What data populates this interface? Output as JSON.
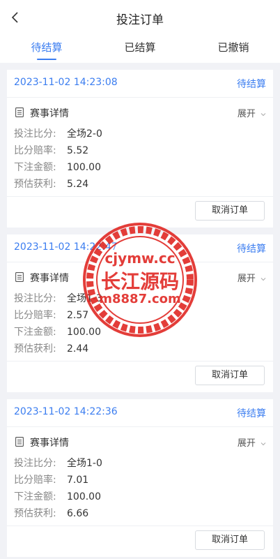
{
  "header": {
    "title": "投注订单"
  },
  "tabs": [
    {
      "label": "待结算"
    },
    {
      "label": "已结算"
    },
    {
      "label": "已撤销"
    }
  ],
  "labels": {
    "detail": "赛事详情",
    "expand": "展开",
    "score": "投注比分:",
    "odds": "比分赔率:",
    "amount": "下注金额:",
    "profit": "预估获利:",
    "cancel": "取消订单"
  },
  "orders": [
    {
      "time": "2023-11-02 14:23:08",
      "status": "待结算",
      "score": "全场2-0",
      "odds": "5.52",
      "amount": "100.00",
      "profit": "5.24"
    },
    {
      "time": "2023-11-02 14:22:47",
      "status": "待结算",
      "score": "全场1-3",
      "odds": "2.57",
      "amount": "100.00",
      "profit": "2.44"
    },
    {
      "time": "2023-11-02 14:22:36",
      "status": "待结算",
      "score": "全场1-0",
      "odds": "7.01",
      "amount": "100.00",
      "profit": "6.66"
    }
  ],
  "watermark": {
    "line1": "cjymw.cc",
    "line2": "长江源码",
    "line3": "m8887.com"
  },
  "colors": {
    "accent": "#3b7df0",
    "watermark": "#e0231e",
    "background": "#f1f2f6"
  }
}
